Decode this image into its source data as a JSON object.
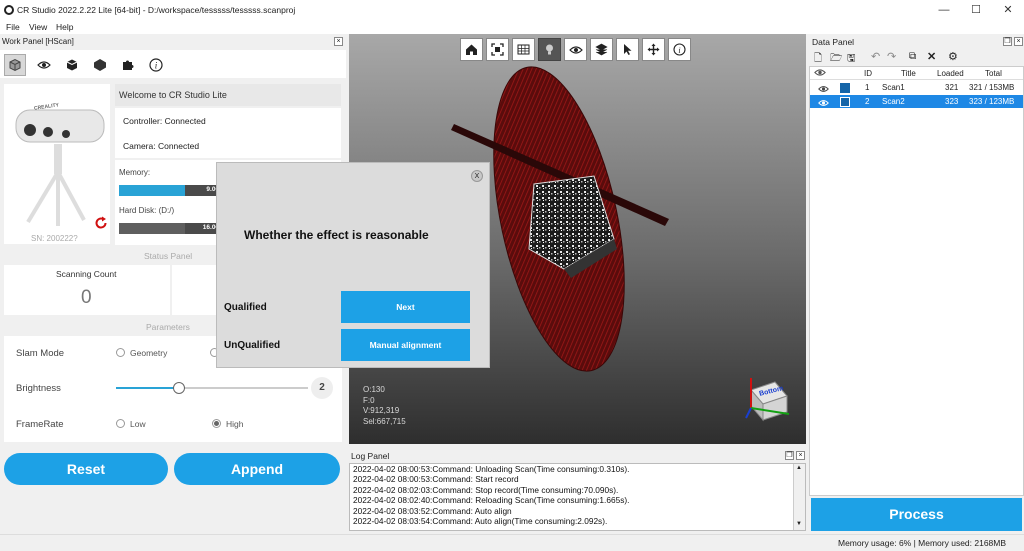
{
  "window": {
    "title": "CR Studio 2022.2.22 Lite [64-bit] - D:/workspace/tesssss/tesssss.scanproj",
    "minimize": "—",
    "maximize": "☐",
    "close": "✕"
  },
  "menu": [
    "File",
    "View",
    "Help"
  ],
  "work_panel": {
    "title": "Work Panel [HScan]",
    "welcome": "Welcome to CR Studio Lite",
    "controller": "Controller: Connected",
    "camera": "Camera: Connected",
    "memory_label": "Memory:",
    "memory_value": "9.0GB/",
    "memory_fraction": 0.6,
    "disk_label": "Hard Disk: (D:/)",
    "disk_value": "16.0GB/",
    "disk_fraction": 0.6,
    "sn": "SN: 200222?",
    "device_brand": "CREALITY",
    "status_panel_label": "Status Panel",
    "scanning_count_label": "Scanning Count",
    "scanning_count_value": "0",
    "parameters_label": "Parameters",
    "slam_mode_label": "Slam Mode",
    "slam_geometry": "Geometry",
    "brightness_label": "Brightness",
    "brightness_value": "2",
    "brightness_fraction": 0.33,
    "framerate_label": "FrameRate",
    "framerate_low": "Low",
    "framerate_high": "High",
    "framerate_selected": "High",
    "reset_label": "Reset",
    "append_label": "Append"
  },
  "dialog": {
    "close": "X",
    "question": "Whether the effect is reasonable",
    "qualified_label": "Qualified",
    "next_button": "Next",
    "unqualified_label": "UnQualified",
    "manual_button": "Manual alignment"
  },
  "viewport": {
    "stats": [
      "O:130",
      "F:0",
      "V:912,319",
      "Sel:667,715"
    ],
    "cube_label": "Bottom"
  },
  "log_panel": {
    "title": "Log Panel",
    "lines": [
      "2022-04-02 08:00:53:Command: Unloading Scan(Time consuming:0.310s).",
      "2022-04-02 08:00:53:Command: Start record",
      "2022-04-02 08:02:03:Command: Stop record(Time consuming:70.090s).",
      "2022-04-02 08:02:40:Command: Reloading Scan(Time consuming:1.665s).",
      "2022-04-02 08:03:52:Command: Auto align",
      "2022-04-02 08:03:54:Command: Auto align(Time consuming:2.092s)."
    ]
  },
  "data_panel": {
    "title": "Data Panel",
    "columns": [
      "ID",
      "Title",
      "Loaded",
      "Total"
    ],
    "rows": [
      {
        "id": "1",
        "title": "Scan1",
        "loaded": "321",
        "total": "321 / 153MB",
        "color": "#1565a8",
        "selected": false
      },
      {
        "id": "2",
        "title": "Scan2",
        "loaded": "323",
        "total": "323 / 123MB",
        "color": "#1565a8",
        "selected": true
      }
    ],
    "process_label": "Process"
  },
  "status_bar": {
    "memory": "Memory usage: 6% | Memory used: 2168MB"
  },
  "colors": {
    "accent": "#1da1e6",
    "selection": "#1e88e5",
    "point_cloud_red": "#7a1212"
  }
}
